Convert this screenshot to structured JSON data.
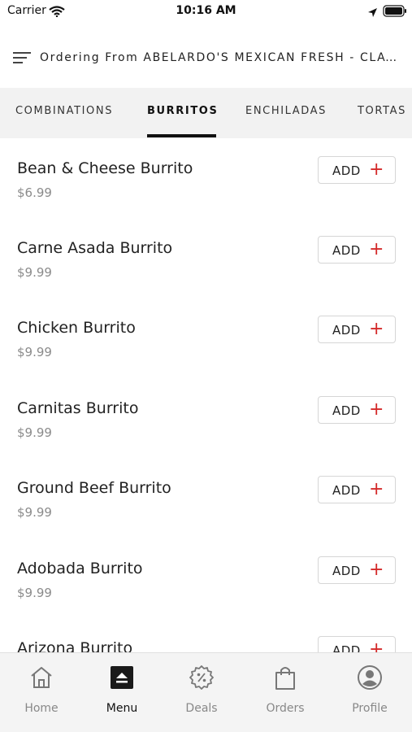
{
  "status_bar": {
    "carrier": "Carrier",
    "time": "10:16 AM"
  },
  "header": {
    "title": "Ordering From ABELARDO'S MEXICAN FRESH - CLAYTON"
  },
  "tabs": [
    {
      "label": "COMBINATIONS"
    },
    {
      "label": "BURRITOS",
      "active": true
    },
    {
      "label": "ENCHILADAS"
    },
    {
      "label": "TORTAS"
    }
  ],
  "items": [
    {
      "name": "Bean & Cheese Burrito",
      "price": "$6.99",
      "add_label": "ADD",
      "add_symbol": "+"
    },
    {
      "name": "Carne Asada Burrito",
      "price": "$9.99",
      "add_label": "ADD",
      "add_symbol": "+"
    },
    {
      "name": "Chicken Burrito",
      "price": "$9.99",
      "add_label": "ADD",
      "add_symbol": "+"
    },
    {
      "name": "Carnitas Burrito",
      "price": "$9.99",
      "add_label": "ADD",
      "add_symbol": "+"
    },
    {
      "name": "Ground Beef Burrito",
      "price": "$9.99",
      "add_label": "ADD",
      "add_symbol": "+"
    },
    {
      "name": "Adobada Burrito",
      "price": "$9.99",
      "add_label": "ADD",
      "add_symbol": "+"
    },
    {
      "name": "Arizona Burrito",
      "price": "",
      "add_label": "ADD",
      "add_symbol": "+"
    }
  ],
  "bottom_nav": [
    {
      "label": "Home",
      "icon": "home-icon"
    },
    {
      "label": "Menu",
      "icon": "menu-icon",
      "active": true
    },
    {
      "label": "Deals",
      "icon": "deals-icon"
    },
    {
      "label": "Orders",
      "icon": "orders-icon"
    },
    {
      "label": "Profile",
      "icon": "profile-icon"
    }
  ],
  "colors": {
    "accent": "#d42a2a",
    "tab_bar_bg": "#f2f2f2",
    "price": "#8b8b8b",
    "nav_inactive": "#888888"
  }
}
